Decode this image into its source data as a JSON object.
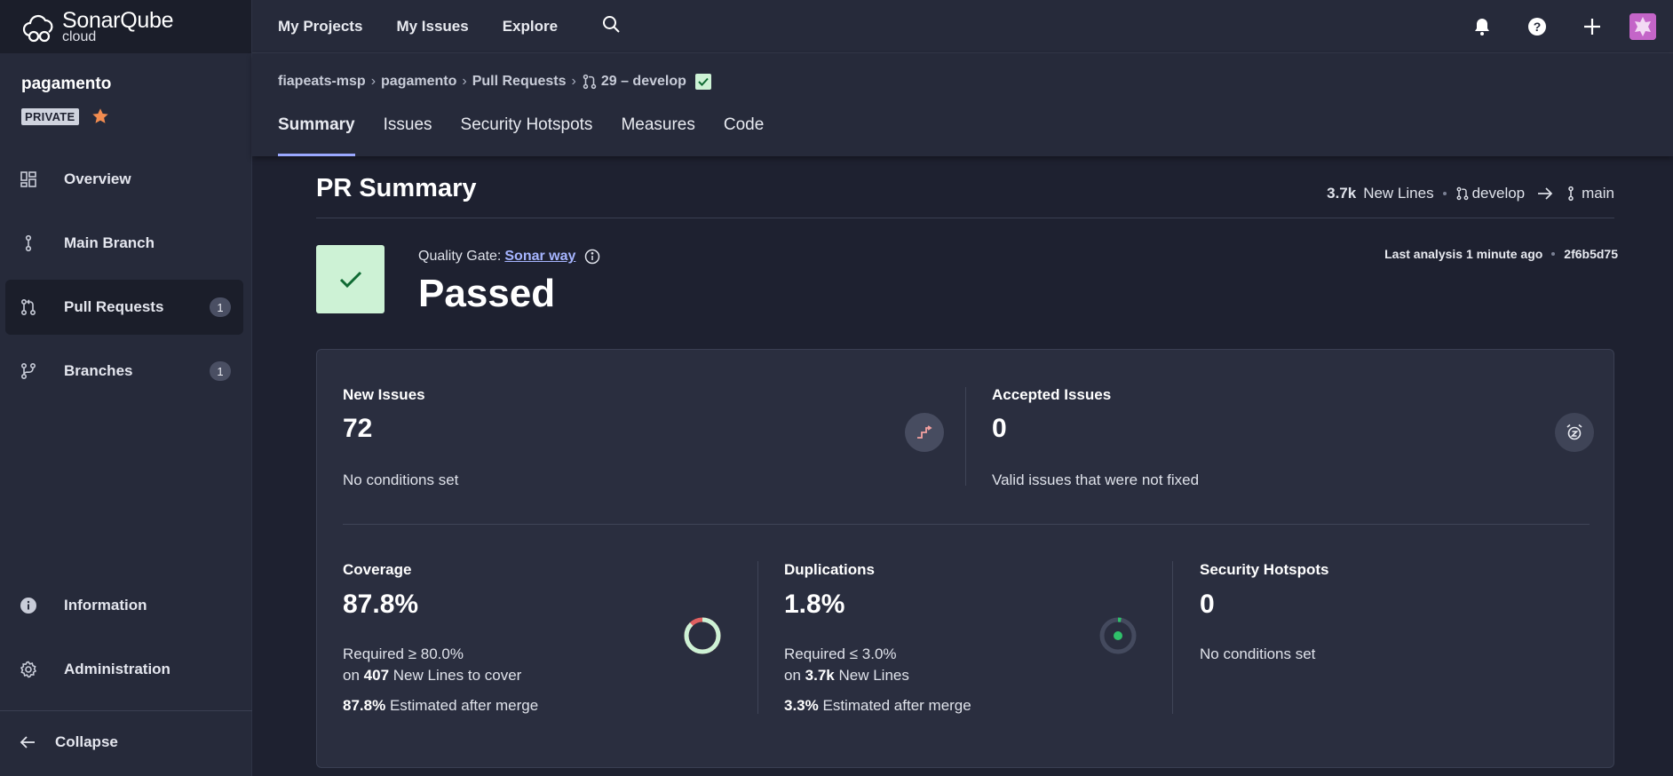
{
  "app": {
    "brand_main": "SonarQube",
    "brand_sub": "cloud"
  },
  "sidebar": {
    "project_name": "pagamento",
    "visibility_badge": "PRIVATE",
    "items": [
      {
        "label": "Overview",
        "icon": "grid-icon"
      },
      {
        "label": "Main Branch",
        "icon": "branch-icon"
      },
      {
        "label": "Pull Requests",
        "icon": "pull-request-icon",
        "count": "1",
        "active": true
      },
      {
        "label": "Branches",
        "icon": "branches-icon",
        "count": "1"
      }
    ],
    "bottom_items": [
      {
        "label": "Information",
        "icon": "info-icon"
      },
      {
        "label": "Administration",
        "icon": "gear-icon"
      }
    ],
    "collapse_label": "Collapse"
  },
  "topnav": {
    "links": [
      "My Projects",
      "My Issues",
      "Explore"
    ]
  },
  "breadcrumb": {
    "org": "fiapeats-msp",
    "project": "pagamento",
    "section": "Pull Requests",
    "pr": "29 – develop"
  },
  "tabs": [
    "Summary",
    "Issues",
    "Security Hotspots",
    "Measures",
    "Code"
  ],
  "summary": {
    "title": "PR Summary",
    "new_lines_value": "3.7k",
    "new_lines_label": "New Lines",
    "source_branch": "develop",
    "target_branch": "main",
    "gate_label": "Quality Gate:",
    "gate_name": "Sonar way",
    "gate_status": "Passed",
    "last_analysis": "Last analysis 1 minute ago",
    "commit": "2f6b5d75"
  },
  "metrics": {
    "new_issues": {
      "title": "New Issues",
      "value": "72",
      "note": "No conditions set"
    },
    "accepted_issues": {
      "title": "Accepted Issues",
      "value": "0",
      "note": "Valid issues that were not fixed"
    },
    "coverage": {
      "title": "Coverage",
      "value": "87.8%",
      "required": "Required ≥ 80.0%",
      "on_prefix": "on",
      "lines": "407",
      "lines_suffix": "New Lines to cover",
      "estimate": "87.8%",
      "estimate_suffix": "Estimated after merge",
      "ratio": 0.878
    },
    "duplications": {
      "title": "Duplications",
      "value": "1.8%",
      "required": "Required ≤ 3.0%",
      "on_prefix": "on",
      "lines": "3.7k",
      "lines_suffix": "New Lines",
      "estimate": "3.3%",
      "estimate_suffix": "Estimated after merge",
      "ratio": 0.018
    },
    "hotspots": {
      "title": "Security Hotspots",
      "value": "0",
      "note": "No conditions set"
    }
  },
  "colors": {
    "pass_green": "#cdf2d5",
    "accent": "#9aa8ff",
    "star": "#f28c50",
    "coverage_red": "#e06060"
  }
}
